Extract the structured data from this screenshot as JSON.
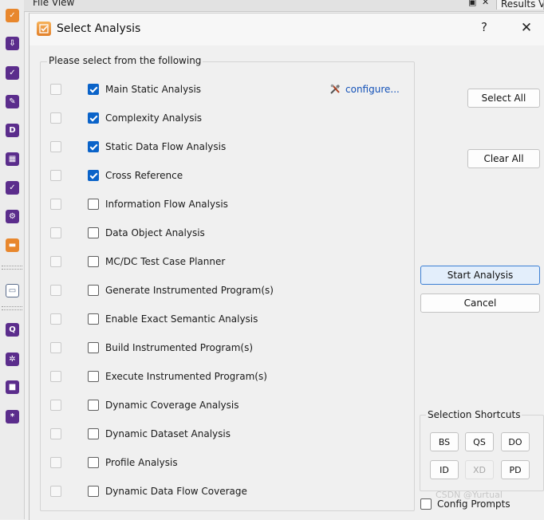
{
  "background": {
    "file_view_label": "File View",
    "results_tab_label": "Results V"
  },
  "dialog": {
    "title": "Select Analysis",
    "help_label": "?",
    "close_label": "✕"
  },
  "group": {
    "title": "Please select from the following",
    "configure_label": "configure..."
  },
  "options": [
    {
      "label": "Main Static Analysis",
      "checked": true
    },
    {
      "label": "Complexity Analysis",
      "checked": true
    },
    {
      "label": "Static Data Flow Analysis",
      "checked": true
    },
    {
      "label": "Cross Reference",
      "checked": true
    },
    {
      "label": "Information Flow Analysis",
      "checked": false
    },
    {
      "label": "Data Object Analysis",
      "checked": false
    },
    {
      "label": "MC/DC Test Case Planner",
      "checked": false
    },
    {
      "label": "Generate Instrumented Program(s)",
      "checked": false
    },
    {
      "label": "Enable Exact Semantic Analysis",
      "checked": false
    },
    {
      "label": "Build Instrumented Program(s)",
      "checked": false
    },
    {
      "label": "Execute Instrumented Program(s)",
      "checked": false
    },
    {
      "label": "Dynamic Coverage Analysis",
      "checked": false
    },
    {
      "label": "Dynamic Dataset Analysis",
      "checked": false
    },
    {
      "label": "Profile Analysis",
      "checked": false
    },
    {
      "label": "Dynamic Data Flow Coverage",
      "checked": false
    }
  ],
  "buttons": {
    "select_all": "Select All",
    "clear_all": "Clear All",
    "start_analysis": "Start Analysis",
    "cancel": "Cancel"
  },
  "shortcuts": {
    "title": "Selection Shortcuts",
    "items": [
      {
        "label": "BS",
        "enabled": true
      },
      {
        "label": "QS",
        "enabled": true
      },
      {
        "label": "DO",
        "enabled": true
      },
      {
        "label": "ID",
        "enabled": true
      },
      {
        "label": "XD",
        "enabled": false
      },
      {
        "label": "PD",
        "enabled": true
      }
    ]
  },
  "config_prompts": {
    "label": "Config Prompts",
    "checked": false
  },
  "watermark": "CSDN @Yurtual",
  "colors": {
    "checked_blue": "#0a63c9",
    "link_blue": "#1452b8",
    "primary_border": "#3c7fd4"
  }
}
